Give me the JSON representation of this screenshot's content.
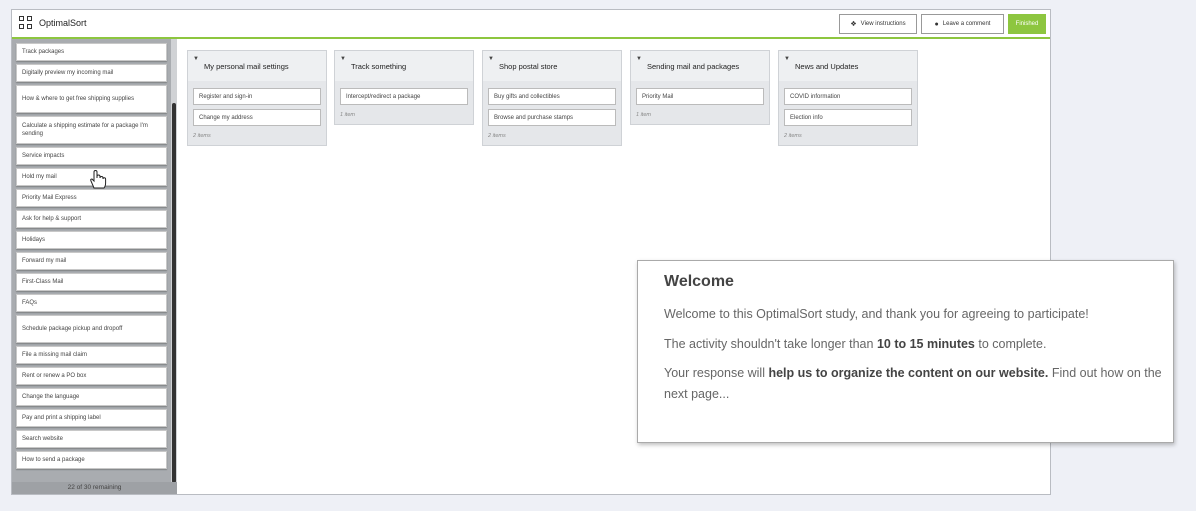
{
  "app": {
    "title": "OptimalSort"
  },
  "toolbar": {
    "instructions_label": "View instructions",
    "comment_label": "Leave a comment",
    "finished_label": "Finished"
  },
  "sidebar": {
    "cards": [
      "Track packages",
      "Digitally preview my incoming mail",
      "How & where to get free shipping supplies",
      "Calculate a shipping estimate for a package I'm sending",
      "Service impacts",
      "Hold my mail",
      "Priority Mail Express",
      "Ask for help & support",
      "Holidays",
      "Forward my mail",
      "First-Class Mail",
      "FAQs",
      "Schedule package pickup and dropoff",
      "File a missing mail claim",
      "Rent or renew a PO box",
      "Change the language",
      "Pay and print a shipping label",
      "Search website",
      "How to send a package"
    ],
    "remaining": "22 of 30 remaining"
  },
  "categories": [
    {
      "name": "My personal mail settings",
      "items": [
        "Register and sign-in",
        "Change my address"
      ],
      "count": "2 items"
    },
    {
      "name": "Track something",
      "items": [
        "Intercept/redirect a package"
      ],
      "count": "1 item"
    },
    {
      "name": "Shop postal store",
      "items": [
        "Buy gifts and collectibles",
        "Browse and purchase stamps"
      ],
      "count": "2 items"
    },
    {
      "name": "Sending mail and packages",
      "items": [
        "Priority Mail"
      ],
      "count": "1 item"
    },
    {
      "name": "News and Updates",
      "items": [
        "COVID information",
        "Election info"
      ],
      "count": "2 items"
    }
  ],
  "welcome": {
    "title": "Welcome",
    "p1": "Welcome to this OptimalSort study, and thank you for agreeing to participate!",
    "p2_pre": "The activity shouldn't take longer than ",
    "p2_bold": "10 to 15 minutes",
    "p2_post": " to complete.",
    "p3_pre": "Your response will ",
    "p3_bold": "help us to organize the content on our website.",
    "p3_post": " Find out how on the next page..."
  },
  "icons": {
    "logo": "grid-logo-icon",
    "instructions": "info-icon",
    "comment": "comment-icon",
    "category_toggle": "triangle-down-icon",
    "cursor": "hand-pointer-icon"
  },
  "colors": {
    "accent": "#8dc63f",
    "sidebar": "#a9acb0"
  }
}
